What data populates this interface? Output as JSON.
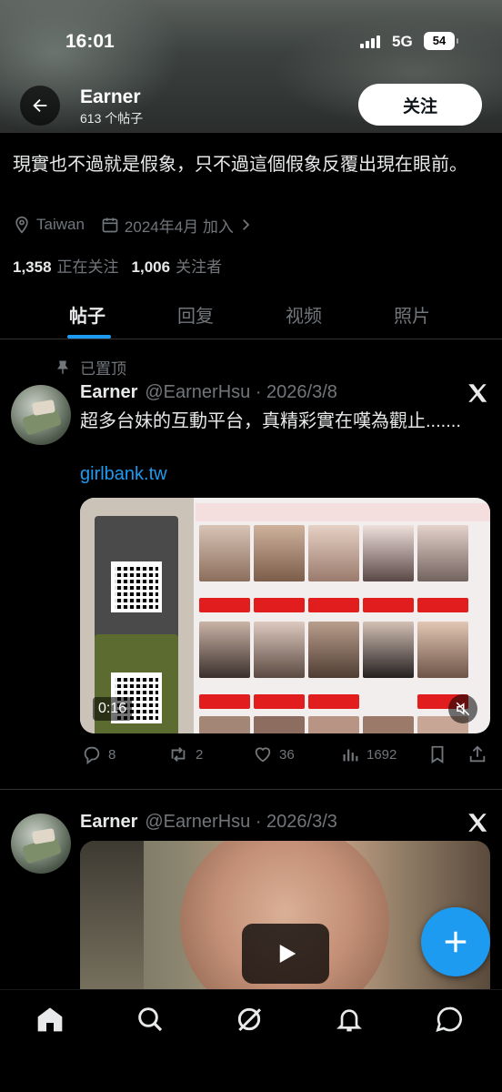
{
  "status_bar": {
    "time": "16:01",
    "network": "5G",
    "battery": "54"
  },
  "profile": {
    "name": "Earner",
    "post_count": "613 个帖子",
    "follow_label": "关注",
    "bio": "現實也不過就是假象，只不過這個假象反覆出現在眼前。",
    "location": "Taiwan",
    "joined": "2024年4月 加入",
    "following_count": "1,358",
    "following_label": "正在关注",
    "followers_count": "1,006",
    "followers_label": "关注者"
  },
  "tabs": [
    "帖子",
    "回复",
    "视频",
    "照片"
  ],
  "pinned_label": "已置顶",
  "posts": [
    {
      "author": "Earner",
      "handle_date": "@EarnerHsu · 2026/3/8",
      "text": "超多台妹的互動平台，真精彩實在嘆為觀止.......",
      "link": "girlbank.tw",
      "video_duration": "0:16",
      "replies": "8",
      "reposts": "2",
      "likes": "36",
      "views": "1692"
    },
    {
      "author": "Earner",
      "handle_date": "@EarnerHsu · 2026/3/3"
    }
  ],
  "media_labels": {
    "ios": "iOS版",
    "android": "Android版",
    "download": "下載檔案"
  },
  "icons": {
    "back": "arrow-left-icon",
    "location": "location-pin-icon",
    "calendar": "calendar-icon",
    "pin": "pin-icon",
    "x": "x-logo-icon",
    "reply": "reply-icon",
    "repost": "repost-icon",
    "like": "heart-icon",
    "views": "views-icon",
    "bookmark": "bookmark-icon",
    "share": "share-icon",
    "compose": "plus-icon",
    "home": "home-icon",
    "search": "search-icon",
    "grok": "grok-icon",
    "notifications": "bell-icon",
    "messages": "messages-icon"
  },
  "colors": {
    "accent": "#1d9bf0",
    "background": "#000000",
    "muted": "#71767b"
  }
}
